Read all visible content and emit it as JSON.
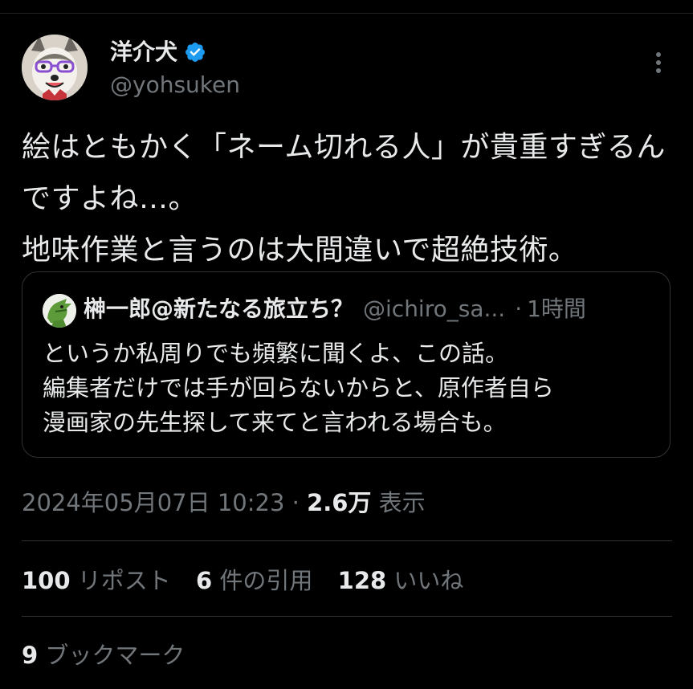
{
  "author": {
    "name": "洋介犬",
    "handle": "@yohsuken",
    "verified": true,
    "verified_color": "#1d9bf0",
    "avatar_icon": "husky-dog-avatar"
  },
  "tweet": {
    "text": "絵はともかく「ネーム切れる人」が貴重すぎるんですよね…。\n地味作業と言うのは大間違いで超絶技術。"
  },
  "quote": {
    "name": "榊一郎@新たなる旅立ち？",
    "handle": "@ichiro_sa...",
    "dot": "·",
    "time": "1時間",
    "text": "というか私周りでも頻繁に聞くよ、この話。\n編集者だけでは手が回らないからと、原作者自ら\n漫画家の先生探して来てと言われる場合も。",
    "avatar_icon": "green-dragon-avatar"
  },
  "meta": {
    "datetime": "2024年05月07日 10:23 · ",
    "views_count": "2.6万",
    "views_label": "表示"
  },
  "stats": {
    "reposts_count": "100",
    "reposts_label": "リポスト",
    "quotes_count": "6",
    "quotes_label": "件の引用",
    "likes_count": "128",
    "likes_label": "いいね",
    "bookmarks_count": "9",
    "bookmarks_label": "ブックマーク"
  },
  "colors": {
    "background": "#000000",
    "text": "#e7e9ea",
    "secondary": "#71767b",
    "border": "#2f3336"
  }
}
